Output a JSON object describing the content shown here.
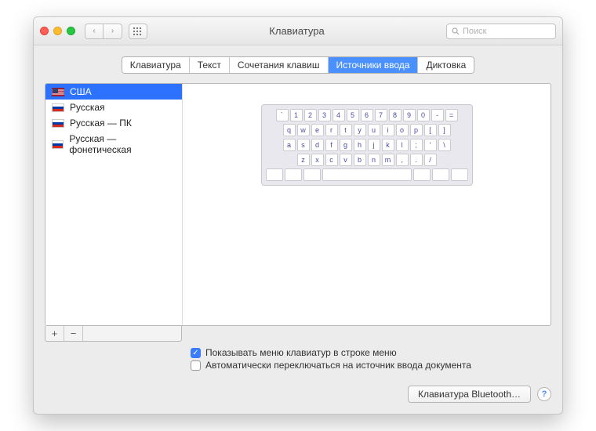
{
  "window": {
    "title": "Клавиатура"
  },
  "search": {
    "placeholder": "Поиск"
  },
  "tabs": [
    {
      "label": "Клавиатура",
      "active": false
    },
    {
      "label": "Текст",
      "active": false
    },
    {
      "label": "Сочетания клавиш",
      "active": false
    },
    {
      "label": "Источники ввода",
      "active": true
    },
    {
      "label": "Диктовка",
      "active": false
    }
  ],
  "sources": [
    {
      "label": "США",
      "flag": "us",
      "selected": true
    },
    {
      "label": "Русская",
      "flag": "ru",
      "selected": false
    },
    {
      "label": "Русская — ПК",
      "flag": "ru",
      "selected": false
    },
    {
      "label": "Русская — фонетическая",
      "flag": "ru",
      "selected": false
    }
  ],
  "keyboard": {
    "rows": [
      [
        "`",
        "1",
        "2",
        "3",
        "4",
        "5",
        "6",
        "7",
        "8",
        "9",
        "0",
        "-",
        "="
      ],
      [
        "q",
        "w",
        "e",
        "r",
        "t",
        "y",
        "u",
        "i",
        "o",
        "p",
        "[",
        "]"
      ],
      [
        "a",
        "s",
        "d",
        "f",
        "g",
        "h",
        "j",
        "k",
        "l",
        ";",
        "'",
        "\\"
      ],
      [
        "z",
        "x",
        "c",
        "v",
        "b",
        "n",
        "m",
        ",",
        ".",
        "/"
      ]
    ]
  },
  "buttons": {
    "add": "+",
    "remove": "−"
  },
  "checkboxes": {
    "show_menu": {
      "label": "Показывать меню клавиатур в строке меню",
      "checked": true
    },
    "auto_switch": {
      "label": "Автоматически переключаться на источник ввода документа",
      "checked": false
    }
  },
  "bluetooth_button": "Клавиатура Bluetooth…",
  "help": "?"
}
